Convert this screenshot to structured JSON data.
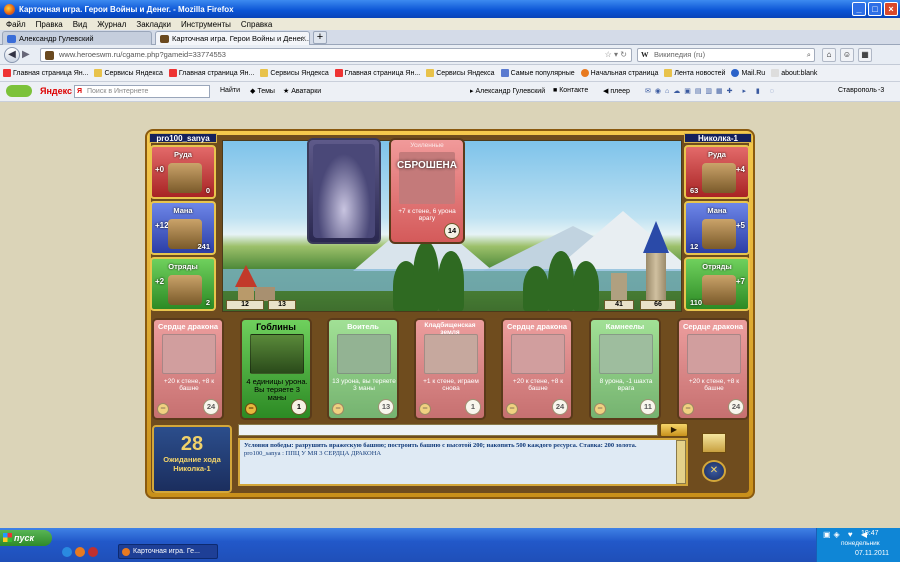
{
  "window": {
    "title": "Карточная игра. Герои Войны и Денег. - Mozilla Firefox"
  },
  "menu": [
    "Файл",
    "Правка",
    "Вид",
    "Журнал",
    "Закладки",
    "Инструменты",
    "Справка"
  ],
  "tabs": [
    {
      "label": "Александр Гулевский"
    },
    {
      "label": "Карточная игра. Герои Войны и Денег..."
    }
  ],
  "nav": {
    "url": "www.heroeswm.ru/cgame.php?gameid=33774553",
    "search_engine": "W",
    "search_placeholder": "Википедия (ru)"
  },
  "bookmarks": [
    {
      "label": "Главная страница Ян...",
      "icon": "yandex-icon"
    },
    {
      "label": "Сервисы Яндекса",
      "icon": "folder-icon"
    },
    {
      "label": "Главная страница Ян...",
      "icon": "yandex-icon"
    },
    {
      "label": "Сервисы Яндекса",
      "icon": "folder-icon"
    },
    {
      "label": "Главная страница Ян...",
      "icon": "yandex-icon"
    },
    {
      "label": "Сервисы Яндекса",
      "icon": "folder-icon"
    },
    {
      "label": "Самые популярные",
      "icon": "star-icon"
    },
    {
      "label": "Начальная страница",
      "icon": "firefox-icon"
    },
    {
      "label": "Лента новостей",
      "icon": "folder-icon"
    },
    {
      "label": "Mail.Ru",
      "icon": "mail-icon"
    },
    {
      "label": "about:blank",
      "icon": "page-icon"
    }
  ],
  "yandex_bar": {
    "logo": "Яндекс",
    "search_placeholder": "Поиск в Интернете",
    "find": "Найти",
    "themes": "Темы",
    "avatars": "Аватарки",
    "user": "Александр Гулевский",
    "contact": "Контакте",
    "player": "плеер",
    "city": "Ставрополь",
    "temp": "-3"
  },
  "game": {
    "left_player": {
      "name": "pro100_sanya",
      "resources": [
        {
          "label": "Руда",
          "inc": "+0",
          "qty": "0",
          "color": "red"
        },
        {
          "label": "Мана",
          "inc": "+12",
          "qty": "241",
          "color": "blue"
        },
        {
          "label": "Отряды",
          "inc": "+2",
          "qty": "2",
          "color": "green"
        }
      ],
      "wall": "12",
      "tower": "13"
    },
    "right_player": {
      "name": "Николка-1",
      "resources": [
        {
          "label": "Руда",
          "inc": "+4",
          "qty": "63",
          "color": "red"
        },
        {
          "label": "Мана",
          "inc": "+5",
          "qty": "12",
          "color": "blue"
        },
        {
          "label": "Отряды",
          "inc": "+7",
          "qty": "110",
          "color": "green"
        }
      ],
      "wall": "41",
      "tower": "66"
    },
    "played_card": {
      "title": "Усиленные",
      "status": "СБРОШЕНА",
      "desc": "+7 к стене, 6 урона врагу",
      "cost": "14"
    },
    "hand": [
      {
        "title": "Сердце дракона",
        "desc": "+20 к стене, +8 к башне",
        "cost": "24",
        "color": "red",
        "active": false
      },
      {
        "title": "Гоблины",
        "desc": "4 единицы урона. Вы теряете 3 маны",
        "cost": "1",
        "color": "green",
        "active": true
      },
      {
        "title": "Воитель",
        "desc": "13 урона, вы теряете 3 маны",
        "cost": "13",
        "color": "green",
        "active": false
      },
      {
        "title": "Кладбищенская земля",
        "desc": "+1 к стене, играем снова",
        "cost": "1",
        "color": "red",
        "active": false
      },
      {
        "title": "Сердце дракона",
        "desc": "+20 к стене, +8 к башне",
        "cost": "24",
        "color": "red",
        "active": false
      },
      {
        "title": "Камнеелы",
        "desc": "8 урона, -1 шахта врага",
        "cost": "11",
        "color": "green",
        "active": false
      },
      {
        "title": "Сердце дракона",
        "desc": "+20 к стене, +8 к башне",
        "cost": "24",
        "color": "red",
        "active": false
      }
    ],
    "turn_number": "28",
    "turn_status": "Ожидание хода Николка-1",
    "chat": [
      "Условия победы: разрушить вражескую башню; построить башню с высотой 200; накопить 500 каждого ресурса. Ставка: 200 золота.",
      "pro100_sanya : ППЦ У МЯ 3 СЕРДЦА ДРАКОНА"
    ]
  },
  "taskbar": {
    "start": "пуск",
    "task": "Карточная игра. Ге...",
    "time": "19:47",
    "day": "понедельник",
    "date": "07.11.2011"
  }
}
